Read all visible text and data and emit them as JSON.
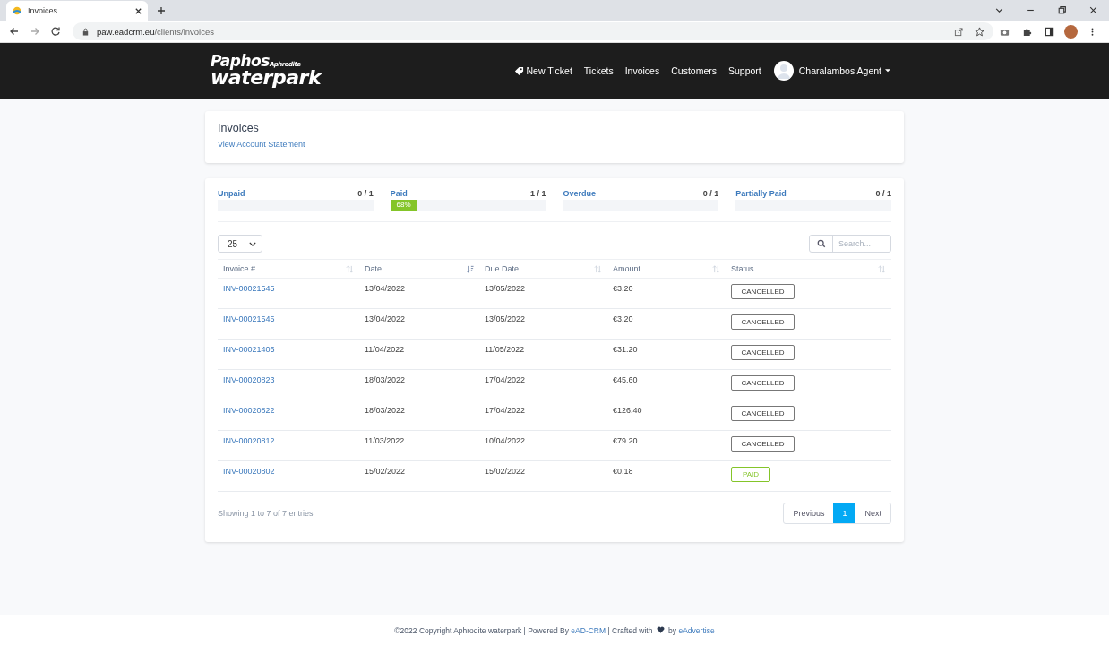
{
  "browser": {
    "tab_title": "Invoices",
    "url_host": "paw.eadcrm.eu",
    "url_path": "/clients/invoices"
  },
  "navbar": {
    "logo_top": "Paphos",
    "logo_small": "Aphrodite",
    "logo_bottom": "waterpark",
    "links": [
      {
        "label": "New Ticket",
        "kind": "ticket"
      },
      {
        "label": "Tickets",
        "kind": "plain"
      },
      {
        "label": "Invoices",
        "kind": "plain"
      },
      {
        "label": "Customers",
        "kind": "plain"
      },
      {
        "label": "Support",
        "kind": "plain"
      }
    ],
    "user": "Charalambos Agent"
  },
  "header": {
    "title": "Invoices",
    "link": "View Account Statement"
  },
  "stats": [
    {
      "label": "Unpaid",
      "count": "0 / 1"
    },
    {
      "label": "Paid",
      "count": "1 / 1",
      "level": 0.17,
      "reading": "68%"
    },
    {
      "label": "Overdue",
      "count": "0 / 1"
    },
    {
      "label": "Partially Paid",
      "count": "0 / 1"
    }
  ],
  "page_length": "25",
  "search": {
    "placeholder": "Search..."
  },
  "columns": [
    {
      "label": "Invoice #",
      "sorted": false
    },
    {
      "label": "Date",
      "sorted": true
    },
    {
      "label": "Due Date",
      "sorted": false
    },
    {
      "label": "Amount",
      "sorted": false
    },
    {
      "label": "Status",
      "sorted": false
    }
  ],
  "rows": [
    {
      "invoice": "INV-00021545",
      "date": "13/04/2022",
      "due_date": "13/05/2022",
      "amount": "€3.20",
      "status": "CANCELLED",
      "kind": "cancelled"
    },
    {
      "invoice": "INV-00021545",
      "date": "13/04/2022",
      "due_date": "13/05/2022",
      "amount": "€3.20",
      "status": "CANCELLED",
      "kind": "cancelled"
    },
    {
      "invoice": "INV-00021405",
      "date": "11/04/2022",
      "due_date": "11/05/2022",
      "amount": "€31.20",
      "status": "CANCELLED",
      "kind": "cancelled"
    },
    {
      "invoice": "INV-00020823",
      "date": "18/03/2022",
      "due_date": "17/04/2022",
      "amount": "€45.60",
      "status": "CANCELLED",
      "kind": "cancelled"
    },
    {
      "invoice": "INV-00020822",
      "date": "18/03/2022",
      "due_date": "17/04/2022",
      "amount": "€126.40",
      "status": "CANCELLED",
      "kind": "cancelled"
    },
    {
      "invoice": "INV-00020812",
      "date": "11/03/2022",
      "due_date": "10/04/2022",
      "amount": "€79.20",
      "status": "CANCELLED",
      "kind": "cancelled"
    },
    {
      "invoice": "INV-00020802",
      "date": "15/02/2022",
      "due_date": "15/02/2022",
      "amount": "€0.18",
      "status": "PAID",
      "kind": "paid"
    }
  ],
  "info": "Showing 1 to 7 of 7 entries",
  "pagination": [
    {
      "label": "Previous",
      "selected": false
    },
    {
      "label": "1",
      "selected": true
    },
    {
      "label": "Next",
      "selected": false
    }
  ],
  "footer": {
    "text_1": "©2022 Copyright Aphrodite waterpark | Powered By ",
    "link_1": "eAD-CRM",
    "text_2": " | Crafted with ",
    "text_3": " by ",
    "link_2": "eAdvertise"
  }
}
